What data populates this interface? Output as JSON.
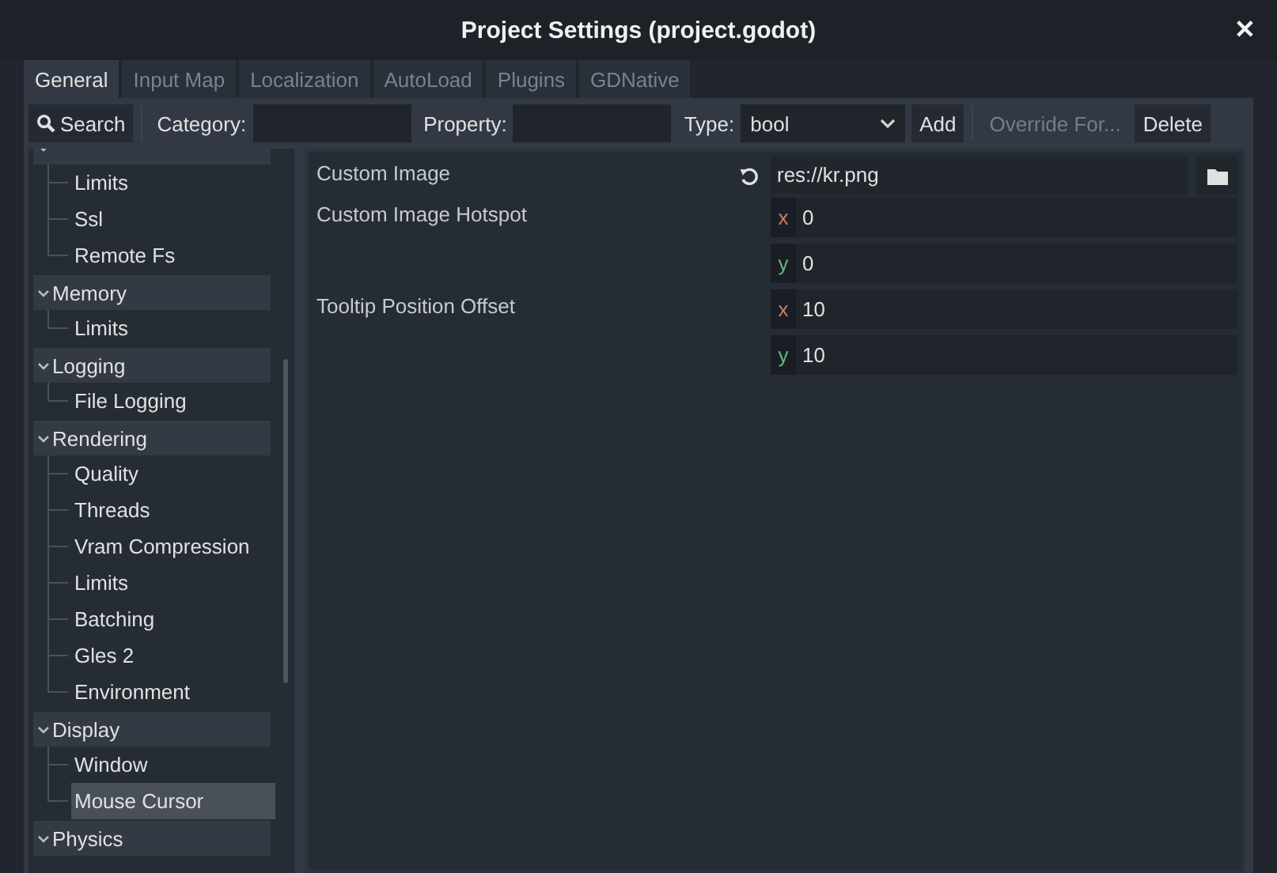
{
  "window": {
    "title": "Project Settings (project.godot)",
    "close": "✕"
  },
  "tabs": [
    {
      "label": "General",
      "selected": true
    },
    {
      "label": "Input Map",
      "selected": false
    },
    {
      "label": "Localization",
      "selected": false
    },
    {
      "label": "AutoLoad",
      "selected": false
    },
    {
      "label": "Plugins",
      "selected": false
    },
    {
      "label": "GDNative",
      "selected": false
    }
  ],
  "toolbar": {
    "search": "Search",
    "category_label": "Category:",
    "property_label": "Property:",
    "type_label": "Type:",
    "type_value": "bool",
    "add": "Add",
    "override": {
      "label": "Override For...",
      "disabled": true
    },
    "delete": "Delete"
  },
  "tree": [
    {
      "expanded": true,
      "selected": false,
      "children": [
        {
          "label": "Limits",
          "selected": false
        },
        {
          "label": "Ssl",
          "selected": false
        },
        {
          "label": "Remote Fs",
          "selected": false
        }
      ]
    },
    {
      "label": "Memory",
      "expanded": true,
      "selected": false,
      "children": [
        {
          "label": "Limits",
          "selected": false
        }
      ]
    },
    {
      "label": "Logging",
      "expanded": true,
      "selected": false,
      "children": [
        {
          "label": "File Logging",
          "selected": false
        }
      ]
    },
    {
      "label": "Rendering",
      "expanded": true,
      "selected": false,
      "children": [
        {
          "label": "Quality",
          "selected": false
        },
        {
          "label": "Threads",
          "selected": false
        },
        {
          "label": "Vram Compression",
          "selected": false
        },
        {
          "label": "Limits",
          "selected": false
        },
        {
          "label": "Batching",
          "selected": false
        },
        {
          "label": "Gles 2",
          "selected": false
        },
        {
          "label": "Environment",
          "selected": false
        }
      ]
    },
    {
      "label": "Display",
      "expanded": true,
      "selected": false,
      "children": [
        {
          "label": "Window",
          "selected": false
        },
        {
          "label": "Mouse Cursor",
          "selected": true
        }
      ]
    },
    {
      "label": "Physics",
      "expanded": true,
      "selected": false
    }
  ],
  "properties": [
    {
      "kind": "path",
      "name": "Custom Image",
      "value": "res://kr.png"
    },
    {
      "kind": "vector",
      "name": "Custom Image Hotspot",
      "components": [
        {
          "axis": "x",
          "value": "0"
        },
        {
          "axis": "y",
          "value": "0"
        }
      ]
    },
    {
      "kind": "vector",
      "name": "Tooltip Position Offset",
      "components": [
        {
          "axis": "x",
          "value": "10"
        },
        {
          "axis": "y",
          "value": "10"
        }
      ]
    }
  ]
}
